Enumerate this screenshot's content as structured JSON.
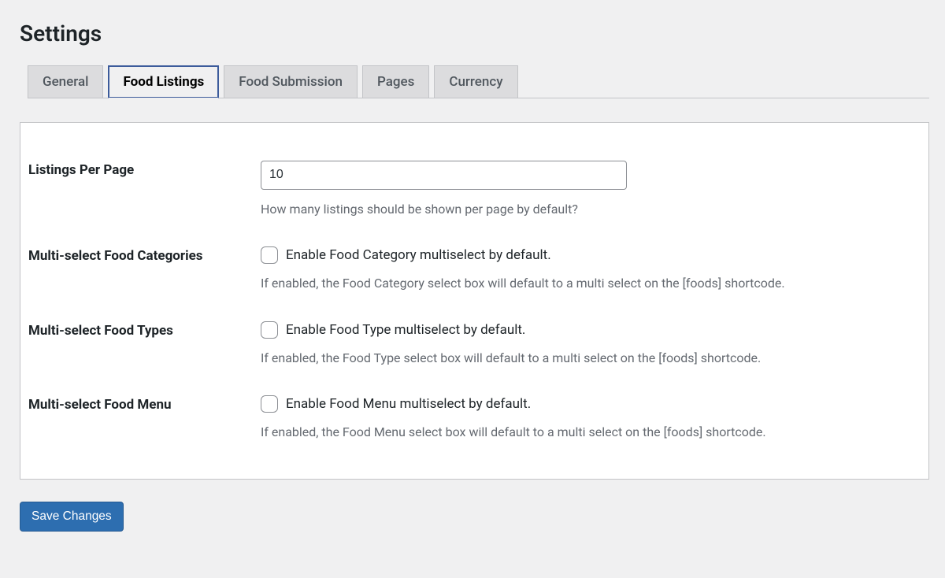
{
  "page_title": "Settings",
  "tabs": {
    "general": "General",
    "food_listings": "Food Listings",
    "food_submission": "Food Submission",
    "pages": "Pages",
    "currency": "Currency"
  },
  "fields": {
    "listings_per_page": {
      "label": "Listings Per Page",
      "value": "10",
      "description": "How many listings should be shown per page by default?"
    },
    "multi_categories": {
      "label": "Multi-select Food Categories",
      "checkbox_label": "Enable Food Category multiselect by default.",
      "description": "If enabled, the Food Category select box will default to a multi select on the [foods] shortcode."
    },
    "multi_types": {
      "label": "Multi-select Food Types",
      "checkbox_label": "Enable Food Type multiselect by default.",
      "description": "If enabled, the Food Type select box will default to a multi select on the [foods] shortcode."
    },
    "multi_menu": {
      "label": "Multi-select Food Menu",
      "checkbox_label": "Enable Food Menu multiselect by default.",
      "description": "If enabled, the Food Menu select box will default to a multi select on the [foods] shortcode."
    }
  },
  "save_button": "Save Changes"
}
